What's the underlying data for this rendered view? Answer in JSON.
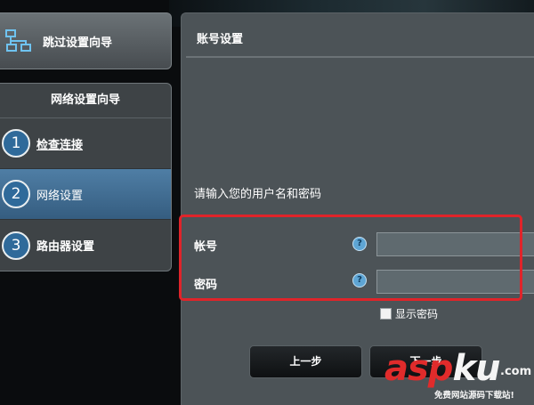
{
  "sidebar": {
    "skip_wizard": {
      "label": "跳过设置向导",
      "icon": "network-icon"
    },
    "wizard": {
      "title": "网络设置向导",
      "steps": [
        {
          "number": "1",
          "label": "检查连接"
        },
        {
          "number": "2",
          "label": "网络设置"
        },
        {
          "number": "3",
          "label": "路由器设置"
        }
      ],
      "active_step": 2
    }
  },
  "main": {
    "title": "账号设置",
    "hint": "请输入您的用户名和密码",
    "account": {
      "label": "帐号",
      "value": ""
    },
    "password": {
      "label": "密码",
      "value": ""
    },
    "help_glyph": "?",
    "show_password_label": "显示密码",
    "show_password_checked": false,
    "prev_button": "上一步",
    "next_button": "下一步"
  },
  "watermark": {
    "brand_red": "asp",
    "brand_white": "ku",
    "suffix": ".com",
    "slogan": "免费网站源码下载站!"
  },
  "colors": {
    "accent_red": "#e0242a",
    "active_step": "#3f6d94",
    "panel": "#4c5357"
  }
}
